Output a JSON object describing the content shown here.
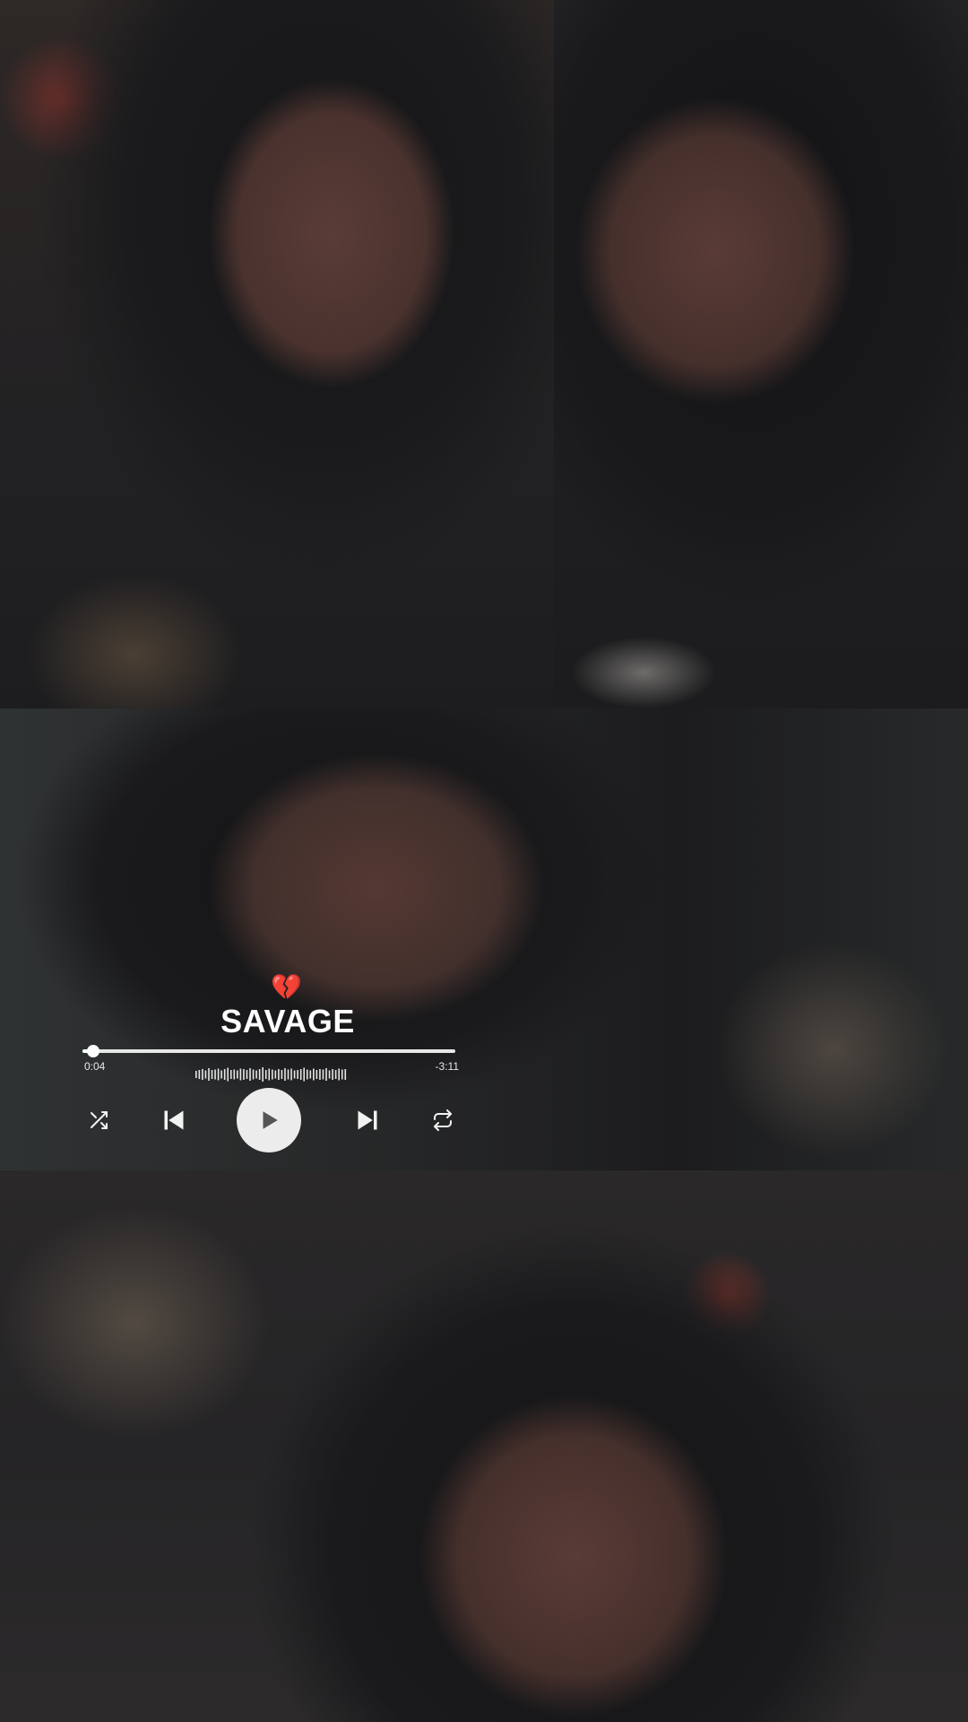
{
  "player": {
    "status_emoji": "💔",
    "song_title": "SAVAGE",
    "time_elapsed": "0:04",
    "time_remaining": "-3:11",
    "progress_fraction": 0.03,
    "controls": {
      "shuffle": "shuffle-icon",
      "previous": "skip-previous-icon",
      "play": "play-icon",
      "next": "skip-next-icon",
      "repeat": "repeat-icon"
    }
  },
  "colors": {
    "text": "#ffffff",
    "play_button_bg": "#ececec",
    "play_icon": "#555555",
    "broken_heart": "#e02b3a"
  }
}
